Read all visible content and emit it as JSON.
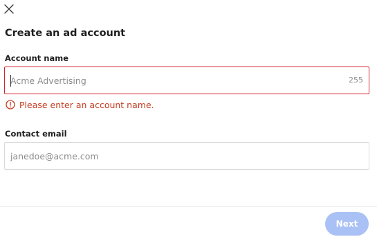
{
  "dialog": {
    "title": "Create an ad account",
    "close_icon": "close-icon"
  },
  "account_name": {
    "label": "Account name",
    "placeholder": "Acme Advertising",
    "value": "",
    "char_limit": "255",
    "error": "Please enter an account name.",
    "error_icon": "alert-circle-icon"
  },
  "contact_email": {
    "label": "Contact email",
    "placeholder": "janedoe@acme.com",
    "value": ""
  },
  "footer": {
    "next_label": "Next"
  },
  "colors": {
    "error": "#c63a1f",
    "error_border": "#d3242d",
    "next_button_disabled": "#a9c1f5"
  }
}
